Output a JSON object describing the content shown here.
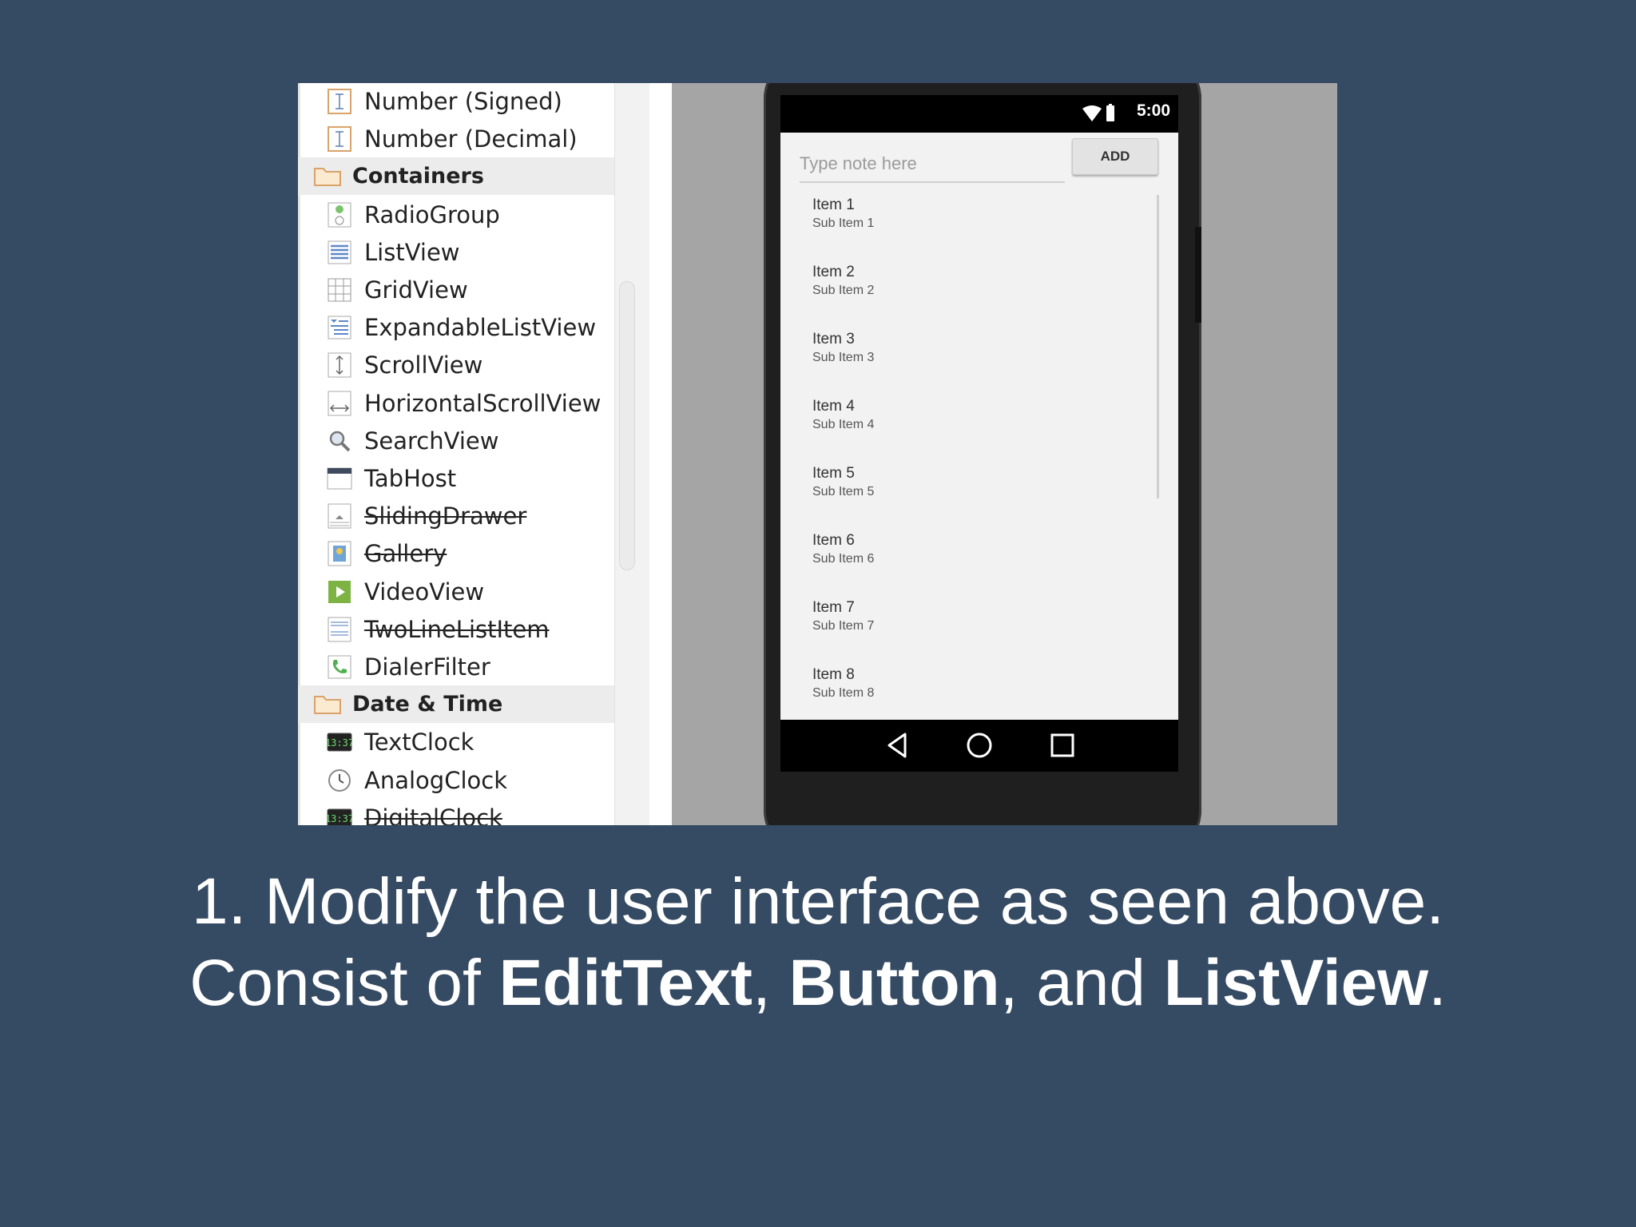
{
  "palette": {
    "items": [
      {
        "label": "Number (Signed)",
        "icon": "text-field-icon",
        "strike": false,
        "category": false
      },
      {
        "label": "Number (Decimal)",
        "icon": "text-field-icon",
        "strike": false,
        "category": false
      },
      {
        "label": "Containers",
        "icon": "folder-icon",
        "strike": false,
        "category": true
      },
      {
        "label": "RadioGroup",
        "icon": "radio-group-icon",
        "strike": false,
        "category": false
      },
      {
        "label": "ListView",
        "icon": "list-view-icon",
        "strike": false,
        "category": false
      },
      {
        "label": "GridView",
        "icon": "grid-view-icon",
        "strike": false,
        "category": false
      },
      {
        "label": "ExpandableListView",
        "icon": "expandable-list-icon",
        "strike": false,
        "category": false
      },
      {
        "label": "ScrollView",
        "icon": "vertical-scroll-icon",
        "strike": false,
        "category": false
      },
      {
        "label": "HorizontalScrollView",
        "icon": "horizontal-scroll-icon",
        "strike": false,
        "category": false
      },
      {
        "label": "SearchView",
        "icon": "search-icon",
        "strike": false,
        "category": false
      },
      {
        "label": "TabHost",
        "icon": "tab-host-icon",
        "strike": false,
        "category": false
      },
      {
        "label": "SlidingDrawer",
        "icon": "sliding-drawer-icon",
        "strike": true,
        "category": false
      },
      {
        "label": "Gallery",
        "icon": "gallery-icon",
        "strike": true,
        "category": false
      },
      {
        "label": "VideoView",
        "icon": "video-play-icon",
        "strike": false,
        "category": false
      },
      {
        "label": "TwoLineListItem",
        "icon": "two-line-list-icon",
        "strike": true,
        "category": false
      },
      {
        "label": "DialerFilter",
        "icon": "phone-icon",
        "strike": false,
        "category": false
      },
      {
        "label": "Date & Time",
        "icon": "folder-icon",
        "strike": false,
        "category": true
      },
      {
        "label": "TextClock",
        "icon": "digital-clock-icon",
        "strike": false,
        "category": false
      },
      {
        "label": "AnalogClock",
        "icon": "analog-clock-icon",
        "strike": false,
        "category": false
      },
      {
        "label": "DigitalClock",
        "icon": "digital-clock-icon",
        "strike": true,
        "category": false
      }
    ]
  },
  "phone": {
    "status_time": "5:00",
    "note_placeholder": "Type note here",
    "add_label": "ADD",
    "list": [
      {
        "title": "Item 1",
        "sub": "Sub Item 1"
      },
      {
        "title": "Item 2",
        "sub": "Sub Item 2"
      },
      {
        "title": "Item 3",
        "sub": "Sub Item 3"
      },
      {
        "title": "Item 4",
        "sub": "Sub Item 4"
      },
      {
        "title": "Item 5",
        "sub": "Sub Item 5"
      },
      {
        "title": "Item 6",
        "sub": "Sub Item 6"
      },
      {
        "title": "Item 7",
        "sub": "Sub Item 7"
      },
      {
        "title": "Item 8",
        "sub": "Sub Item 8"
      }
    ],
    "nav": [
      "back-icon",
      "home-icon",
      "recents-icon"
    ]
  },
  "caption": {
    "line1": "1. Modify the user interface as seen above.",
    "line2_prefix": "Consist of ",
    "edittext": "EditText",
    "comma": ", ",
    "button": "Button",
    "and": ", and ",
    "listview": "ListView",
    "period": "."
  },
  "colors": {
    "background": "#354a63",
    "canvas_gray": "#a5a5a5",
    "category_bg": "#ececec"
  }
}
